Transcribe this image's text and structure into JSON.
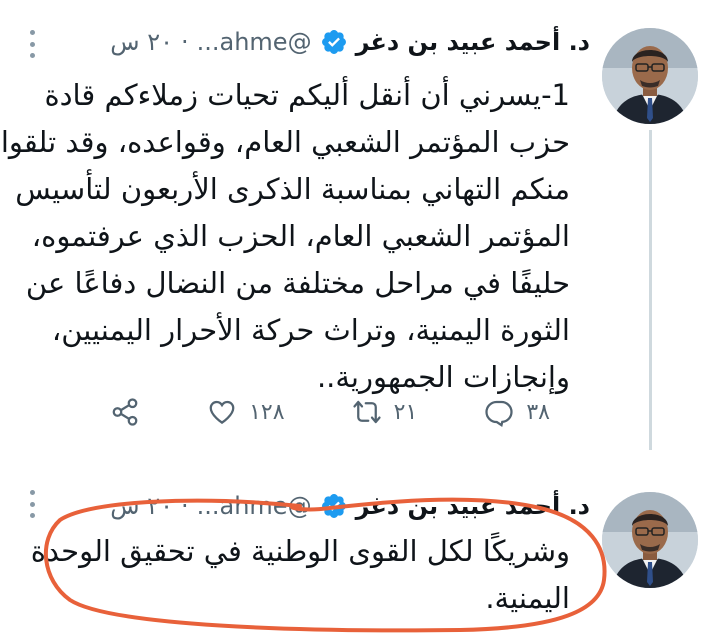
{
  "tweets": [
    {
      "author_name": "د. أحمد عبيد بن دغر",
      "handle": "@ahme...",
      "dot": "·",
      "time": "٢٠ س",
      "avatar": "avatar-photo",
      "body_lines": [
        "1-يسرني أن أنقل أليكم تحيات زملاءكم قادة",
        "حزب المؤتمر الشعبي العام، وقواعده، وقد تلقوا",
        "منكم التهاني بمناسبة الذكرى الأربعون لتأسيس",
        "المؤتمر الشعبي العام، الحزب الذي عرفتموه،",
        "حليفًا في مراحل مختلفة من النضال دفاعًا عن",
        "الثورة اليمنية، وتراث حركة الأحرار اليمنيين،",
        "وإنجازات الجمهورية.."
      ],
      "actions": {
        "reply_count": "٣٨",
        "retweet_count": "٢١",
        "like_count": "١٢٨",
        "share_icon": "share-icon"
      }
    },
    {
      "author_name": "د. أحمد عبيد بن دغر",
      "handle": "@ahme...",
      "dot": "·",
      "time": "٢٠ س",
      "avatar": "avatar-photo",
      "body_lines": [
        "وشريكًا لكل القوى الوطنية في تحقيق الوحدة",
        "اليمنية."
      ]
    }
  ],
  "colors": {
    "verified": "#1d9bf0",
    "annotation": "#e8613a",
    "muted": "#536471"
  }
}
